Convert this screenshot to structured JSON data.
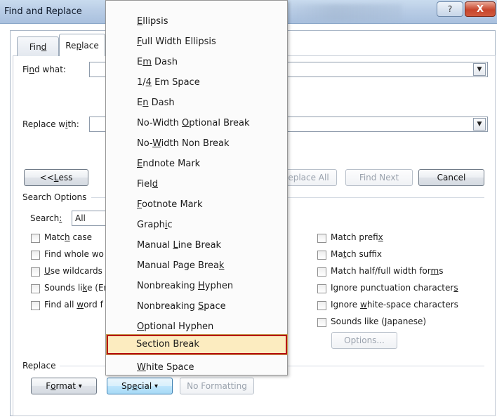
{
  "window": {
    "title": "Find and Replace",
    "help_glyph": "?",
    "close_glyph": "X"
  },
  "tabs": {
    "find": {
      "pre": "Fin",
      "acc": "d",
      "post": ""
    },
    "replace": {
      "pre": "Re",
      "acc": "p",
      "post": "lace"
    }
  },
  "fields": {
    "find_what": {
      "pre": "Fi",
      "acc": "n",
      "post": "d what:",
      "value": ""
    },
    "replace_with": {
      "pre": "Replace w",
      "acc": "i",
      "post": "th:",
      "value": ""
    }
  },
  "buttons": {
    "less": {
      "pre": "<< ",
      "acc": "L",
      "post": "ess"
    },
    "replace_all": "eplace All",
    "find_next": "Find Next",
    "cancel": "Cancel",
    "options": "Options...",
    "format": {
      "pre": "F",
      "acc": "o",
      "post": "rmat",
      "arrow": "▾"
    },
    "special": {
      "pre": "Sp",
      "acc": "e",
      "post": "cial",
      "arrow": "▾"
    },
    "no_formatting": "No Formatting"
  },
  "search_options": {
    "group_label": "Search Options",
    "search": {
      "pre": "Search",
      "acc": ":",
      "post": "",
      "value": "All"
    },
    "left_checkboxes": [
      {
        "pre": "Matc",
        "acc": "h",
        "post": " case"
      },
      {
        "pre": "Find whole wo",
        "acc": "",
        "post": ""
      },
      {
        "pre": "",
        "acc": "U",
        "post": "se wildcards"
      },
      {
        "pre": "Sounds li",
        "acc": "k",
        "post": "e (Er"
      },
      {
        "pre": "Find all ",
        "acc": "w",
        "post": "ord f"
      }
    ],
    "right_checkboxes": [
      {
        "pre": "Match prefi",
        "acc": "x",
        "post": ""
      },
      {
        "pre": "Ma",
        "acc": "t",
        "post": "ch suffix"
      },
      {
        "pre": "Match half/full width for",
        "acc": "m",
        "post": "s"
      },
      {
        "pre": "Ignore punctuation character",
        "acc": "s",
        "post": ""
      },
      {
        "pre": "Ignore ",
        "acc": "w",
        "post": "hite-space characters"
      },
      {
        "pre": "Sounds like (",
        "acc": "J",
        "post": "apanese)"
      }
    ]
  },
  "replace_group_label": "Replace",
  "special_menu": {
    "items": [
      {
        "pre": "",
        "acc": "E",
        "post": "llipsis"
      },
      {
        "pre": "",
        "acc": "F",
        "post": "ull Width Ellipsis"
      },
      {
        "pre": "E",
        "acc": "m",
        "post": " Dash"
      },
      {
        "pre": "1/",
        "acc": "4",
        "post": " Em Space"
      },
      {
        "pre": "E",
        "acc": "n",
        "post": " Dash"
      },
      {
        "pre": "No-Width ",
        "acc": "O",
        "post": "ptional Break"
      },
      {
        "pre": "No-",
        "acc": "W",
        "post": "idth Non Break"
      },
      {
        "pre": "",
        "acc": "E",
        "post": "ndnote Mark"
      },
      {
        "pre": "Fiel",
        "acc": "d",
        "post": ""
      },
      {
        "pre": "",
        "acc": "F",
        "post": "ootnote Mark"
      },
      {
        "pre": "Graph",
        "acc": "i",
        "post": "c"
      },
      {
        "pre": "Manual ",
        "acc": "L",
        "post": "ine Break"
      },
      {
        "pre": "Manual Page Brea",
        "acc": "k",
        "post": ""
      },
      {
        "pre": "Nonbreaking ",
        "acc": "H",
        "post": "yphen"
      },
      {
        "pre": "Nonbreaking ",
        "acc": "S",
        "post": "pace"
      },
      {
        "pre": "",
        "acc": "O",
        "post": "ptional Hyphen"
      },
      {
        "pre": "Section Break",
        "acc": "",
        "post": ""
      },
      {
        "pre": "",
        "acc": "W",
        "post": "hite Space"
      }
    ],
    "highlighted_index": 16,
    "highlight_color": "#fcecc0",
    "highlight_border_color": "#b80d14"
  },
  "icons": {
    "combo_arrow": "▼"
  }
}
